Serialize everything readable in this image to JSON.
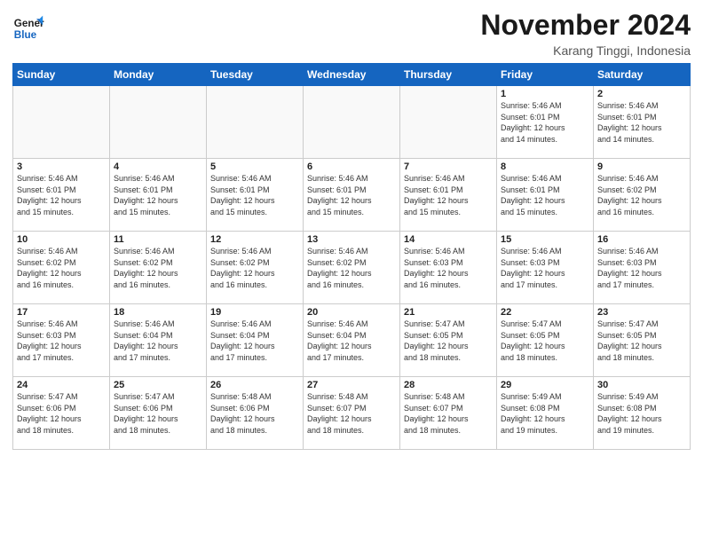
{
  "header": {
    "logo_line1": "General",
    "logo_line2": "Blue",
    "month": "November 2024",
    "location": "Karang Tinggi, Indonesia"
  },
  "weekdays": [
    "Sunday",
    "Monday",
    "Tuesday",
    "Wednesday",
    "Thursday",
    "Friday",
    "Saturday"
  ],
  "weeks": [
    [
      {
        "day": "",
        "info": ""
      },
      {
        "day": "",
        "info": ""
      },
      {
        "day": "",
        "info": ""
      },
      {
        "day": "",
        "info": ""
      },
      {
        "day": "",
        "info": ""
      },
      {
        "day": "1",
        "info": "Sunrise: 5:46 AM\nSunset: 6:01 PM\nDaylight: 12 hours\nand 14 minutes."
      },
      {
        "day": "2",
        "info": "Sunrise: 5:46 AM\nSunset: 6:01 PM\nDaylight: 12 hours\nand 14 minutes."
      }
    ],
    [
      {
        "day": "3",
        "info": "Sunrise: 5:46 AM\nSunset: 6:01 PM\nDaylight: 12 hours\nand 15 minutes."
      },
      {
        "day": "4",
        "info": "Sunrise: 5:46 AM\nSunset: 6:01 PM\nDaylight: 12 hours\nand 15 minutes."
      },
      {
        "day": "5",
        "info": "Sunrise: 5:46 AM\nSunset: 6:01 PM\nDaylight: 12 hours\nand 15 minutes."
      },
      {
        "day": "6",
        "info": "Sunrise: 5:46 AM\nSunset: 6:01 PM\nDaylight: 12 hours\nand 15 minutes."
      },
      {
        "day": "7",
        "info": "Sunrise: 5:46 AM\nSunset: 6:01 PM\nDaylight: 12 hours\nand 15 minutes."
      },
      {
        "day": "8",
        "info": "Sunrise: 5:46 AM\nSunset: 6:01 PM\nDaylight: 12 hours\nand 15 minutes."
      },
      {
        "day": "9",
        "info": "Sunrise: 5:46 AM\nSunset: 6:02 PM\nDaylight: 12 hours\nand 16 minutes."
      }
    ],
    [
      {
        "day": "10",
        "info": "Sunrise: 5:46 AM\nSunset: 6:02 PM\nDaylight: 12 hours\nand 16 minutes."
      },
      {
        "day": "11",
        "info": "Sunrise: 5:46 AM\nSunset: 6:02 PM\nDaylight: 12 hours\nand 16 minutes."
      },
      {
        "day": "12",
        "info": "Sunrise: 5:46 AM\nSunset: 6:02 PM\nDaylight: 12 hours\nand 16 minutes."
      },
      {
        "day": "13",
        "info": "Sunrise: 5:46 AM\nSunset: 6:02 PM\nDaylight: 12 hours\nand 16 minutes."
      },
      {
        "day": "14",
        "info": "Sunrise: 5:46 AM\nSunset: 6:03 PM\nDaylight: 12 hours\nand 16 minutes."
      },
      {
        "day": "15",
        "info": "Sunrise: 5:46 AM\nSunset: 6:03 PM\nDaylight: 12 hours\nand 17 minutes."
      },
      {
        "day": "16",
        "info": "Sunrise: 5:46 AM\nSunset: 6:03 PM\nDaylight: 12 hours\nand 17 minutes."
      }
    ],
    [
      {
        "day": "17",
        "info": "Sunrise: 5:46 AM\nSunset: 6:03 PM\nDaylight: 12 hours\nand 17 minutes."
      },
      {
        "day": "18",
        "info": "Sunrise: 5:46 AM\nSunset: 6:04 PM\nDaylight: 12 hours\nand 17 minutes."
      },
      {
        "day": "19",
        "info": "Sunrise: 5:46 AM\nSunset: 6:04 PM\nDaylight: 12 hours\nand 17 minutes."
      },
      {
        "day": "20",
        "info": "Sunrise: 5:46 AM\nSunset: 6:04 PM\nDaylight: 12 hours\nand 17 minutes."
      },
      {
        "day": "21",
        "info": "Sunrise: 5:47 AM\nSunset: 6:05 PM\nDaylight: 12 hours\nand 18 minutes."
      },
      {
        "day": "22",
        "info": "Sunrise: 5:47 AM\nSunset: 6:05 PM\nDaylight: 12 hours\nand 18 minutes."
      },
      {
        "day": "23",
        "info": "Sunrise: 5:47 AM\nSunset: 6:05 PM\nDaylight: 12 hours\nand 18 minutes."
      }
    ],
    [
      {
        "day": "24",
        "info": "Sunrise: 5:47 AM\nSunset: 6:06 PM\nDaylight: 12 hours\nand 18 minutes."
      },
      {
        "day": "25",
        "info": "Sunrise: 5:47 AM\nSunset: 6:06 PM\nDaylight: 12 hours\nand 18 minutes."
      },
      {
        "day": "26",
        "info": "Sunrise: 5:48 AM\nSunset: 6:06 PM\nDaylight: 12 hours\nand 18 minutes."
      },
      {
        "day": "27",
        "info": "Sunrise: 5:48 AM\nSunset: 6:07 PM\nDaylight: 12 hours\nand 18 minutes."
      },
      {
        "day": "28",
        "info": "Sunrise: 5:48 AM\nSunset: 6:07 PM\nDaylight: 12 hours\nand 18 minutes."
      },
      {
        "day": "29",
        "info": "Sunrise: 5:49 AM\nSunset: 6:08 PM\nDaylight: 12 hours\nand 19 minutes."
      },
      {
        "day": "30",
        "info": "Sunrise: 5:49 AM\nSunset: 6:08 PM\nDaylight: 12 hours\nand 19 minutes."
      }
    ]
  ]
}
